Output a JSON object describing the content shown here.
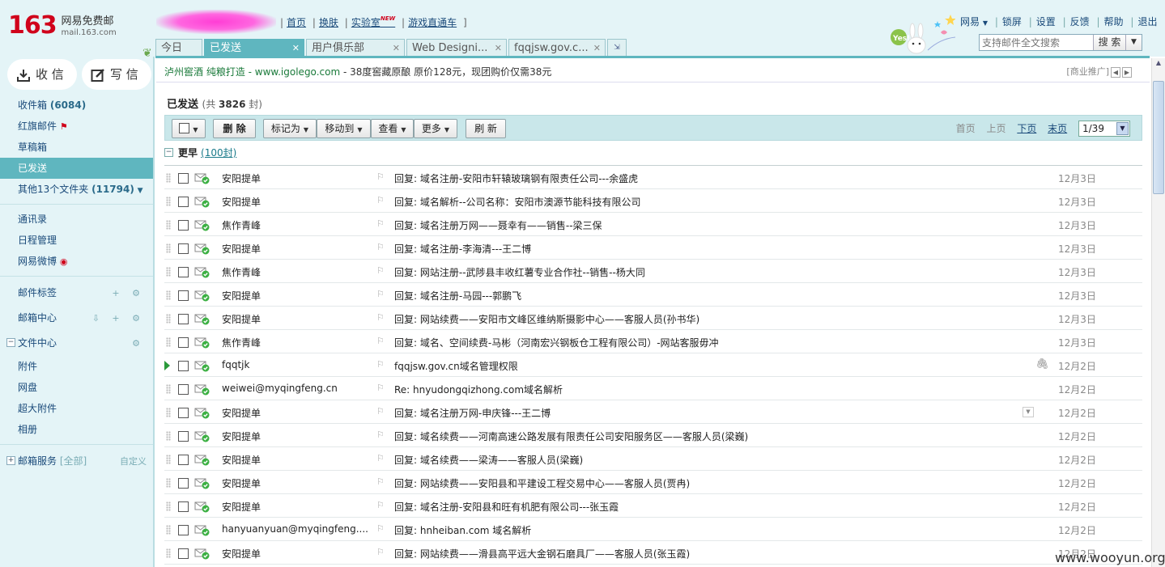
{
  "logo": {
    "number": "163",
    "name": "网易免费邮",
    "domain": "mail.163.com"
  },
  "toplinks": [
    {
      "label": "首页"
    },
    {
      "label": "换肤"
    },
    {
      "label": "实验室",
      "badge": "NEW"
    },
    {
      "label": "游戏直通车"
    }
  ],
  "toplinks_end": "]",
  "rightlinks": [
    "网易",
    "锁屏",
    "设置",
    "反馈",
    "帮助",
    "退出"
  ],
  "search": {
    "placeholder": "支持邮件全文搜索",
    "button": "搜 索"
  },
  "tabs": [
    {
      "label": "今日",
      "active": false,
      "closable": false
    },
    {
      "label": "已发送",
      "active": true,
      "closable": true
    },
    {
      "label": "用户俱乐部",
      "active": false,
      "closable": true
    },
    {
      "label": "Web Designi...",
      "active": false,
      "closable": true
    },
    {
      "label": "fqqjsw.gov.c...",
      "active": false,
      "closable": true
    }
  ],
  "sidebar": {
    "receive": "收 信",
    "compose": "写 信",
    "folders": [
      {
        "label": "收件箱",
        "count": "(6084)"
      },
      {
        "label": "红旗邮件",
        "flag": true
      },
      {
        "label": "草稿箱"
      },
      {
        "label": "已发送",
        "active": true
      },
      {
        "label": "其他13个文件夹",
        "count": "(11794)",
        "dropdown": true
      }
    ],
    "apps": [
      "通讯录",
      "日程管理",
      "网易微博"
    ],
    "sections": [
      {
        "label": "邮件标签",
        "tools": "+ ⚙"
      },
      {
        "label": "邮箱中心",
        "tools": "⇩ + ⚙"
      },
      {
        "label": "文件中心",
        "tools": "⚙",
        "expanded": true
      }
    ],
    "file_items": [
      "附件",
      "网盘",
      "超大附件",
      "相册"
    ],
    "service": {
      "label": "邮箱服务",
      "all": "[全部]",
      "custom": "自定义"
    }
  },
  "ad": {
    "link": "泸州窖酒 纯粮打造 - www.igolego.com",
    "text": " - 38度窖藏原酿 原价128元，现团购价仅需38元",
    "right": "[商业推广]"
  },
  "folder": {
    "title": "已发送",
    "count_prefix": "(共 ",
    "count": "3826",
    "count_suffix": " 封)"
  },
  "toolbar": {
    "delete": "删 除",
    "mark": "标记为",
    "move": "移动到",
    "view": "查看",
    "more": "更多",
    "refresh": "刷 新",
    "pager": {
      "first": "首页",
      "prev": "上页",
      "next": "下页",
      "last": "末页",
      "current": "1/39"
    }
  },
  "group": {
    "title": "更早",
    "count": "(100封)"
  },
  "mails": [
    {
      "from": "安阳提单",
      "subject": "回复: 域名注册-安阳市轩辕玻璃钢有限责任公司---余盛虎",
      "date": "12月3日"
    },
    {
      "from": "安阳提单",
      "subject": "回复: 域名解析--公司名称：安阳市澳源节能科技有限公司",
      "date": "12月3日"
    },
    {
      "from": "焦作青峰",
      "subject": "回复: 域名注册万网——聂幸有——销售--梁三保",
      "date": "12月3日"
    },
    {
      "from": "安阳提单",
      "subject": "回复: 域名注册-李海清---王二博",
      "date": "12月3日"
    },
    {
      "from": "焦作青峰",
      "subject": "回复: 网站注册--武陟县丰收红薯专业合作社--销售--杨大同",
      "date": "12月3日"
    },
    {
      "from": "安阳提单",
      "subject": "回复: 域名注册-马园---郭鹏飞",
      "date": "12月3日"
    },
    {
      "from": "安阳提单",
      "subject": "回复: 网站续费——安阳市文峰区维纳斯摄影中心——客服人员(孙书华)",
      "date": "12月3日"
    },
    {
      "from": "焦作青峰",
      "subject": "回复: 域名、空间续费-马彬（河南宏兴钢板仓工程有限公司）-网站客服毋冲",
      "date": "12月3日"
    },
    {
      "from": "fqqtjk",
      "subject": "fqqjsw.gov.cn域名管理权限",
      "date": "12月2日",
      "attachment": true,
      "current": true
    },
    {
      "from": "weiwei@myqingfeng.cn",
      "subject": "Re: hnyudongqizhong.com域名解析",
      "date": "12月2日"
    },
    {
      "from": "安阳提单",
      "subject": "回复: 域名注册万网-申庆锋---王二博",
      "date": "12月2日",
      "menu": true
    },
    {
      "from": "安阳提单",
      "subject": "回复: 域名续费——河南高速公路发展有限责任公司安阳服务区——客服人员(梁巍)",
      "date": "12月2日"
    },
    {
      "from": "安阳提单",
      "subject": "回复: 域名续费——梁涛——客服人员(梁巍)",
      "date": "12月2日"
    },
    {
      "from": "安阳提单",
      "subject": "回复: 网站续费——安阳县和平建设工程交易中心——客服人员(贾冉)",
      "date": "12月2日"
    },
    {
      "from": "安阳提单",
      "subject": "回复: 域名注册-安阳县和旺有机肥有限公司---张玉霞",
      "date": "12月2日"
    },
    {
      "from": "hanyuanyuan@myqingfeng....",
      "subject": "回复: hnheiban.com 域名解析",
      "date": "12月2日"
    },
    {
      "from": "安阳提单",
      "subject": "回复: 网站续费——滑县高平远大金钢石磨具厂——客服人员(张玉霞)",
      "date": "12月2日"
    }
  ],
  "watermark": "www.wooyun.org",
  "colors": {
    "accent": "#5fb6bf",
    "sidebar_bg": "#e4f4f7",
    "toolbar_bg": "#c9e7ea",
    "logo_red": "#d0021b"
  }
}
